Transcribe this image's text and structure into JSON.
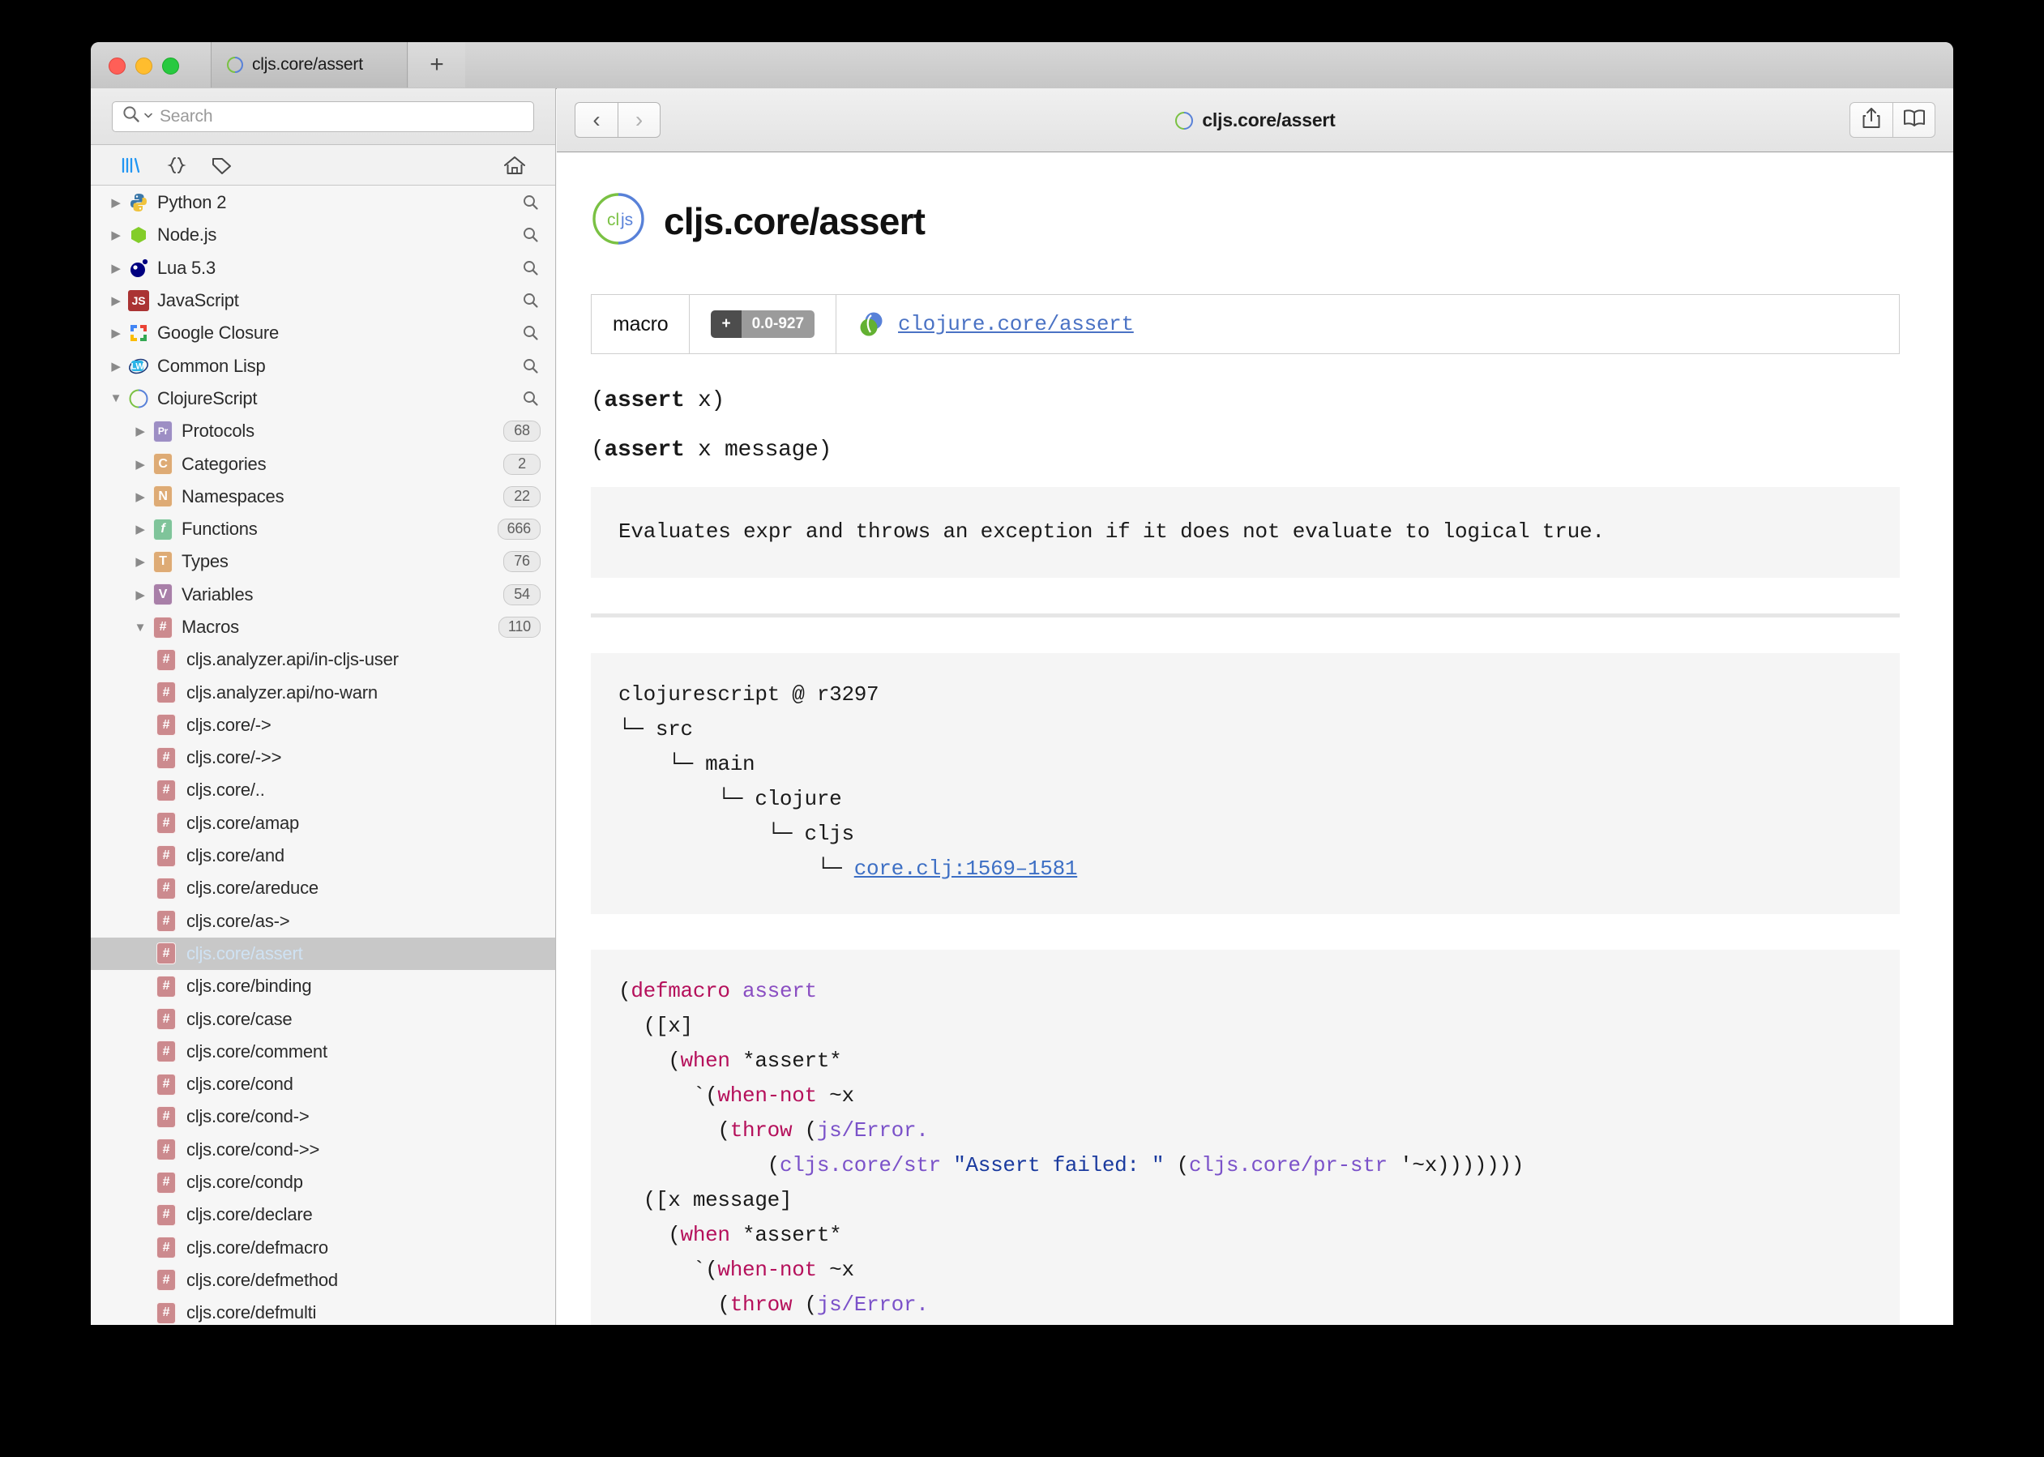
{
  "window": {
    "traffic_lights": [
      "close",
      "minimize",
      "zoom"
    ],
    "tab_label": "cljs.core/assert",
    "new_tab_label": "+"
  },
  "sidebar": {
    "search": {
      "placeholder": "Search",
      "value": ""
    },
    "toolbar": {
      "docsets_icon": "books-icon",
      "snippets_icon": "braces-icon",
      "tags_icon": "tag-icon",
      "home_icon": "home-icon"
    },
    "docsets": [
      {
        "label": "Python 2",
        "icon": "python-icon",
        "expanded": false,
        "action": "search-icon"
      },
      {
        "label": "Node.js",
        "icon": "nodejs-icon",
        "expanded": false,
        "action": "search-icon"
      },
      {
        "label": "Lua 5.3",
        "icon": "lua-icon",
        "expanded": false,
        "action": "search-icon"
      },
      {
        "label": "JavaScript",
        "icon": "javascript-icon",
        "expanded": false,
        "action": "search-icon"
      },
      {
        "label": "Google Closure",
        "icon": "google-closure-icon",
        "expanded": false,
        "action": "search-icon"
      },
      {
        "label": "Common Lisp",
        "icon": "common-lisp-icon",
        "expanded": false,
        "action": "search-icon"
      },
      {
        "label": "ClojureScript",
        "icon": "clojurescript-icon",
        "expanded": true,
        "action": "search-icon"
      }
    ],
    "categories": [
      {
        "label": "Protocols",
        "icon": "protocol-icon",
        "count": "68",
        "expanded": false
      },
      {
        "label": "Categories",
        "icon": "category-icon",
        "count": "2",
        "expanded": false
      },
      {
        "label": "Namespaces",
        "icon": "namespace-icon",
        "count": "22",
        "expanded": false
      },
      {
        "label": "Functions",
        "icon": "function-icon",
        "count": "666",
        "expanded": false
      },
      {
        "label": "Types",
        "icon": "type-icon",
        "count": "76",
        "expanded": false
      },
      {
        "label": "Variables",
        "icon": "variable-icon",
        "count": "54",
        "expanded": false
      },
      {
        "label": "Macros",
        "icon": "macro-icon",
        "count": "110",
        "expanded": true
      }
    ],
    "macros": [
      {
        "label": "cljs.analyzer.api/in-cljs-user",
        "selected": false
      },
      {
        "label": "cljs.analyzer.api/no-warn",
        "selected": false
      },
      {
        "label": "cljs.core/->",
        "selected": false
      },
      {
        "label": "cljs.core/->>",
        "selected": false
      },
      {
        "label": "cljs.core/..",
        "selected": false
      },
      {
        "label": "cljs.core/amap",
        "selected": false
      },
      {
        "label": "cljs.core/and",
        "selected": false
      },
      {
        "label": "cljs.core/areduce",
        "selected": false
      },
      {
        "label": "cljs.core/as->",
        "selected": false
      },
      {
        "label": "cljs.core/assert",
        "selected": true
      },
      {
        "label": "cljs.core/binding",
        "selected": false
      },
      {
        "label": "cljs.core/case",
        "selected": false
      },
      {
        "label": "cljs.core/comment",
        "selected": false
      },
      {
        "label": "cljs.core/cond",
        "selected": false
      },
      {
        "label": "cljs.core/cond->",
        "selected": false
      },
      {
        "label": "cljs.core/cond->>",
        "selected": false
      },
      {
        "label": "cljs.core/condp",
        "selected": false
      },
      {
        "label": "cljs.core/declare",
        "selected": false
      },
      {
        "label": "cljs.core/defmacro",
        "selected": false
      },
      {
        "label": "cljs.core/defmethod",
        "selected": false
      },
      {
        "label": "cljs.core/defmulti",
        "selected": false
      }
    ]
  },
  "main": {
    "toolbar": {
      "back_label": "‹",
      "forward_label": "›",
      "title": "cljs.core/assert",
      "share_icon": "share-icon",
      "bookmark_icon": "book-icon"
    },
    "page_title": "cljs.core/assert",
    "logo_icon": "cljs-logo-icon",
    "infobar": {
      "kind": "macro",
      "version_plus": "+",
      "version": "0.0-927",
      "related_icon": "clojure-logo-icon",
      "related_link": "clojure.core/assert"
    },
    "signatures": [
      {
        "head": "(",
        "name": "assert",
        "args": " x)"
      },
      {
        "head": "(",
        "name": "assert",
        "args": " x message)"
      }
    ],
    "description": "Evaluates expr and throws an exception if it does not evaluate to\nlogical true.",
    "source_tree": {
      "line1": "clojurescript @ r3297",
      "line2": "└─ src",
      "line3": "    └─ main",
      "line4": "        └─ clojure",
      "line5": "            └─ cljs",
      "line6_prefix": "                └─ ",
      "line6_link": "core.clj:1569–1581"
    },
    "code_lines": [
      [
        {
          "t": "(",
          "c": ""
        },
        {
          "t": "defmacro",
          "c": "tok-kw"
        },
        {
          "t": " ",
          "c": ""
        },
        {
          "t": "assert",
          "c": "tok-def"
        }
      ],
      [
        {
          "t": "  ([x]",
          "c": ""
        }
      ],
      [
        {
          "t": "    (",
          "c": ""
        },
        {
          "t": "when",
          "c": "tok-kw"
        },
        {
          "t": " *assert*",
          "c": ""
        }
      ],
      [
        {
          "t": "      `(",
          "c": ""
        },
        {
          "t": "when-not",
          "c": "tok-kw"
        },
        {
          "t": " ~x",
          "c": ""
        }
      ],
      [
        {
          "t": "        (",
          "c": ""
        },
        {
          "t": "throw",
          "c": "tok-kw"
        },
        {
          "t": " (",
          "c": ""
        },
        {
          "t": "js/Error.",
          "c": "tok-ns"
        }
      ],
      [
        {
          "t": "            (",
          "c": ""
        },
        {
          "t": "cljs.core/str",
          "c": "tok-ns"
        },
        {
          "t": " ",
          "c": ""
        },
        {
          "t": "\"Assert failed: \"",
          "c": "tok-str"
        },
        {
          "t": " (",
          "c": ""
        },
        {
          "t": "cljs.core/pr-str",
          "c": "tok-ns"
        },
        {
          "t": " '~x)))))))",
          "c": ""
        }
      ],
      [
        {
          "t": "  ([x message]",
          "c": ""
        }
      ],
      [
        {
          "t": "    (",
          "c": ""
        },
        {
          "t": "when",
          "c": "tok-kw"
        },
        {
          "t": " *assert*",
          "c": ""
        }
      ],
      [
        {
          "t": "      `(",
          "c": ""
        },
        {
          "t": "when-not",
          "c": "tok-kw"
        },
        {
          "t": " ~x",
          "c": ""
        }
      ],
      [
        {
          "t": "        (",
          "c": ""
        },
        {
          "t": "throw",
          "c": "tok-kw"
        },
        {
          "t": " (",
          "c": ""
        },
        {
          "t": "js/Error.",
          "c": "tok-ns"
        }
      ]
    ]
  },
  "colors": {
    "selection_bg": "#c8c8c8",
    "selection_text": "#cfe2f3",
    "link": "#3d6fc4",
    "code_bg": "#f5f5f5",
    "keyword": "#b5105b",
    "namespace": "#7b52c9",
    "string": "#1a3a9e",
    "cljs_green": "#7ac143",
    "cljs_blue": "#5881d8"
  }
}
